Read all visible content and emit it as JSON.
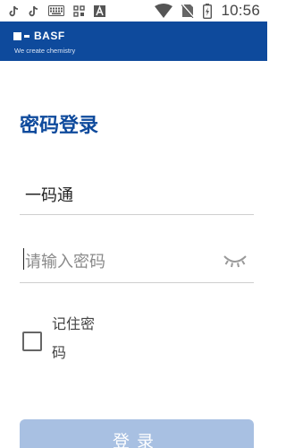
{
  "status_bar": {
    "time": "10:56",
    "left_icons": [
      "tiktok-icon",
      "tiktok-icon",
      "keyboard-icon",
      "qr-grid-icon",
      "font-a-icon"
    ],
    "right_icons": [
      "wifi-icon",
      "no-sim-icon",
      "battery-charging-icon"
    ]
  },
  "header": {
    "brand_name": "BASF",
    "tagline": "We create chemistry",
    "background_color": "#0e4a9c"
  },
  "login": {
    "title": "密码登录",
    "account_value": "一码通",
    "password_placeholder": "请输入密码",
    "remember_label": "记住密码",
    "submit_label": "登录",
    "accent_color": "#0e4a9c",
    "button_color": "#a8c0e2"
  }
}
